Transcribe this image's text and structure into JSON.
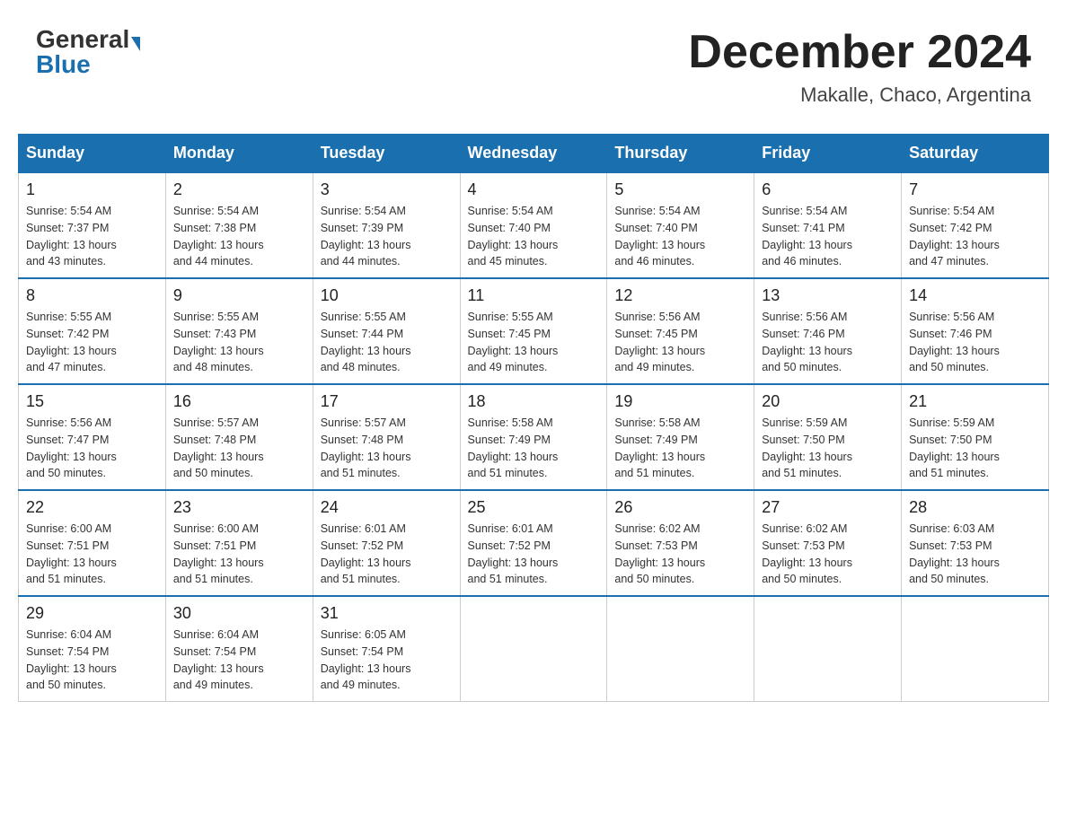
{
  "logo": {
    "general": "General",
    "blue": "Blue"
  },
  "header": {
    "title": "December 2024",
    "subtitle": "Makalle, Chaco, Argentina"
  },
  "weekdays": [
    "Sunday",
    "Monday",
    "Tuesday",
    "Wednesday",
    "Thursday",
    "Friday",
    "Saturday"
  ],
  "weeks": [
    [
      {
        "day": "1",
        "sunrise": "5:54 AM",
        "sunset": "7:37 PM",
        "daylight": "13 hours and 43 minutes."
      },
      {
        "day": "2",
        "sunrise": "5:54 AM",
        "sunset": "7:38 PM",
        "daylight": "13 hours and 44 minutes."
      },
      {
        "day": "3",
        "sunrise": "5:54 AM",
        "sunset": "7:39 PM",
        "daylight": "13 hours and 44 minutes."
      },
      {
        "day": "4",
        "sunrise": "5:54 AM",
        "sunset": "7:40 PM",
        "daylight": "13 hours and 45 minutes."
      },
      {
        "day": "5",
        "sunrise": "5:54 AM",
        "sunset": "7:40 PM",
        "daylight": "13 hours and 46 minutes."
      },
      {
        "day": "6",
        "sunrise": "5:54 AM",
        "sunset": "7:41 PM",
        "daylight": "13 hours and 46 minutes."
      },
      {
        "day": "7",
        "sunrise": "5:54 AM",
        "sunset": "7:42 PM",
        "daylight": "13 hours and 47 minutes."
      }
    ],
    [
      {
        "day": "8",
        "sunrise": "5:55 AM",
        "sunset": "7:42 PM",
        "daylight": "13 hours and 47 minutes."
      },
      {
        "day": "9",
        "sunrise": "5:55 AM",
        "sunset": "7:43 PM",
        "daylight": "13 hours and 48 minutes."
      },
      {
        "day": "10",
        "sunrise": "5:55 AM",
        "sunset": "7:44 PM",
        "daylight": "13 hours and 48 minutes."
      },
      {
        "day": "11",
        "sunrise": "5:55 AM",
        "sunset": "7:45 PM",
        "daylight": "13 hours and 49 minutes."
      },
      {
        "day": "12",
        "sunrise": "5:56 AM",
        "sunset": "7:45 PM",
        "daylight": "13 hours and 49 minutes."
      },
      {
        "day": "13",
        "sunrise": "5:56 AM",
        "sunset": "7:46 PM",
        "daylight": "13 hours and 50 minutes."
      },
      {
        "day": "14",
        "sunrise": "5:56 AM",
        "sunset": "7:46 PM",
        "daylight": "13 hours and 50 minutes."
      }
    ],
    [
      {
        "day": "15",
        "sunrise": "5:56 AM",
        "sunset": "7:47 PM",
        "daylight": "13 hours and 50 minutes."
      },
      {
        "day": "16",
        "sunrise": "5:57 AM",
        "sunset": "7:48 PM",
        "daylight": "13 hours and 50 minutes."
      },
      {
        "day": "17",
        "sunrise": "5:57 AM",
        "sunset": "7:48 PM",
        "daylight": "13 hours and 51 minutes."
      },
      {
        "day": "18",
        "sunrise": "5:58 AM",
        "sunset": "7:49 PM",
        "daylight": "13 hours and 51 minutes."
      },
      {
        "day": "19",
        "sunrise": "5:58 AM",
        "sunset": "7:49 PM",
        "daylight": "13 hours and 51 minutes."
      },
      {
        "day": "20",
        "sunrise": "5:59 AM",
        "sunset": "7:50 PM",
        "daylight": "13 hours and 51 minutes."
      },
      {
        "day": "21",
        "sunrise": "5:59 AM",
        "sunset": "7:50 PM",
        "daylight": "13 hours and 51 minutes."
      }
    ],
    [
      {
        "day": "22",
        "sunrise": "6:00 AM",
        "sunset": "7:51 PM",
        "daylight": "13 hours and 51 minutes."
      },
      {
        "day": "23",
        "sunrise": "6:00 AM",
        "sunset": "7:51 PM",
        "daylight": "13 hours and 51 minutes."
      },
      {
        "day": "24",
        "sunrise": "6:01 AM",
        "sunset": "7:52 PM",
        "daylight": "13 hours and 51 minutes."
      },
      {
        "day": "25",
        "sunrise": "6:01 AM",
        "sunset": "7:52 PM",
        "daylight": "13 hours and 51 minutes."
      },
      {
        "day": "26",
        "sunrise": "6:02 AM",
        "sunset": "7:53 PM",
        "daylight": "13 hours and 50 minutes."
      },
      {
        "day": "27",
        "sunrise": "6:02 AM",
        "sunset": "7:53 PM",
        "daylight": "13 hours and 50 minutes."
      },
      {
        "day": "28",
        "sunrise": "6:03 AM",
        "sunset": "7:53 PM",
        "daylight": "13 hours and 50 minutes."
      }
    ],
    [
      {
        "day": "29",
        "sunrise": "6:04 AM",
        "sunset": "7:54 PM",
        "daylight": "13 hours and 50 minutes."
      },
      {
        "day": "30",
        "sunrise": "6:04 AM",
        "sunset": "7:54 PM",
        "daylight": "13 hours and 49 minutes."
      },
      {
        "day": "31",
        "sunrise": "6:05 AM",
        "sunset": "7:54 PM",
        "daylight": "13 hours and 49 minutes."
      },
      null,
      null,
      null,
      null
    ]
  ],
  "labels": {
    "sunrise": "Sunrise:",
    "sunset": "Sunset:",
    "daylight": "Daylight:"
  }
}
